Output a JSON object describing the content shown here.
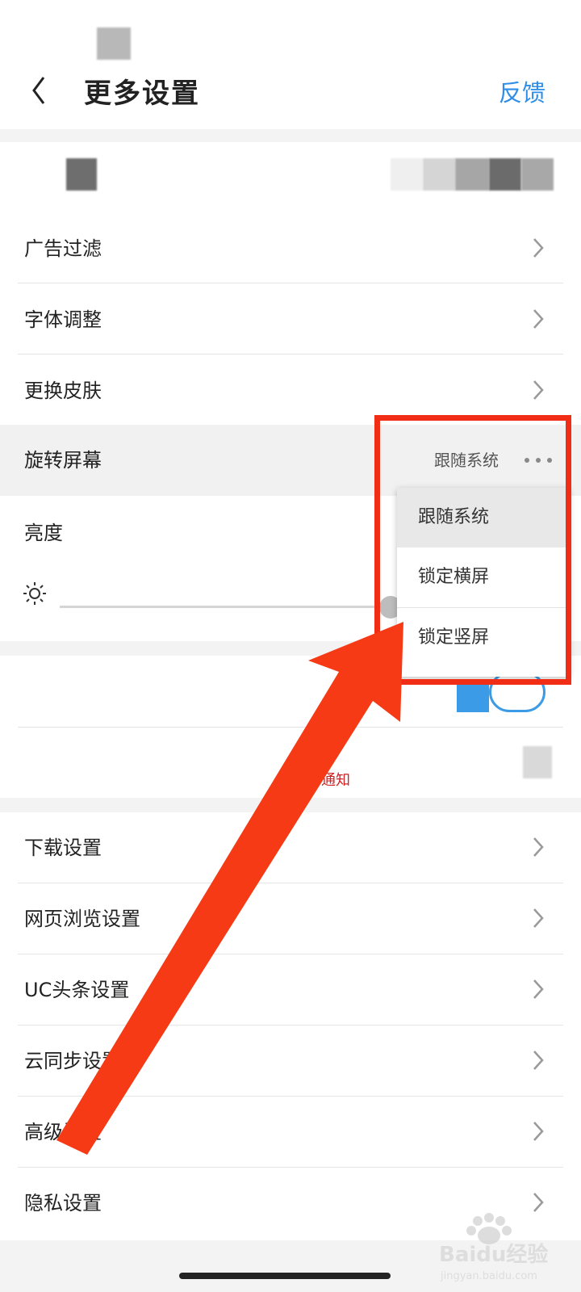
{
  "header": {
    "title": "更多设置",
    "feedback_label": "反馈",
    "back_icon": "chevron-left-icon"
  },
  "settings_group_1": [
    {
      "label": "广告过滤",
      "icon": "chevron-right-icon"
    },
    {
      "label": "字体调整",
      "icon": "chevron-right-icon"
    },
    {
      "label": "更换皮肤",
      "icon": "chevron-right-icon"
    }
  ],
  "rotate": {
    "label": "旋转屏幕",
    "value": "跟随系统",
    "more_icon": "more-dots-icon"
  },
  "brightness": {
    "label": "亮度",
    "icon": "sun-icon"
  },
  "dropdown": {
    "options": [
      "跟随系统",
      "锁定横屏",
      "锁定竖屏"
    ],
    "selected": "跟随系统"
  },
  "notification_hint": "许通知",
  "settings_group_2": [
    {
      "label": "下载设置",
      "icon": "chevron-right-icon"
    },
    {
      "label": "网页浏览设置",
      "icon": "chevron-right-icon"
    },
    {
      "label": "UC头条设置",
      "icon": "chevron-right-icon"
    },
    {
      "label": "云同步设置",
      "icon": "chevron-right-icon"
    },
    {
      "label": "高级设置",
      "icon": "chevron-right-icon"
    },
    {
      "label": "隐私设置",
      "icon": "chevron-right-icon"
    }
  ],
  "watermark": {
    "brand": "Baidu经验",
    "url": "jingyan.baidu.com"
  },
  "colors": {
    "accent": "#2d8de8",
    "annotation_red": "#f12d15",
    "toggle_blue": "#3b9be6"
  }
}
